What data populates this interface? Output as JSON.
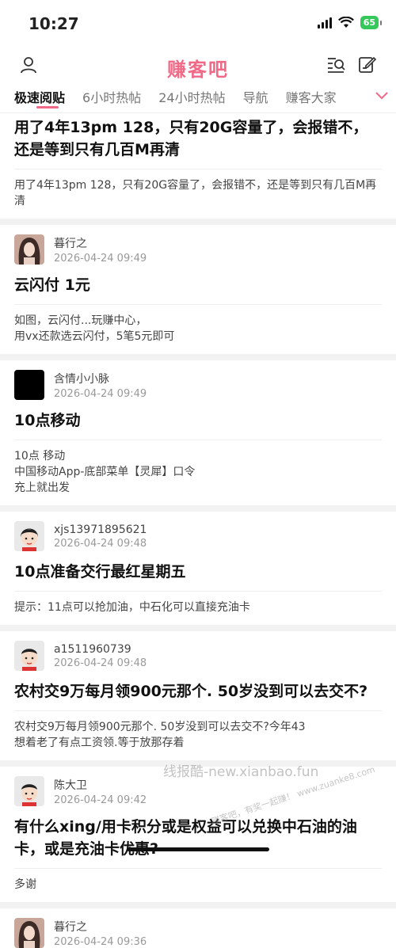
{
  "status": {
    "time": "10:27",
    "battery": "65"
  },
  "header": {
    "title": "赚客吧"
  },
  "tabs": [
    "极速阅贴",
    "6小时热帖",
    "24小时热帖",
    "导航",
    "赚客大家"
  ],
  "posts": [
    {
      "title": "用了4年13pm 128，只有20G容量了，会报错不，还是等到只有几百M再清",
      "summary": "用了4年13pm 128，只有20G容量了，会报错不，还是等到只有几百M再清"
    },
    {
      "author": "暮行之",
      "date": "2026-04-24 09:49",
      "title": "云闪付  1元",
      "summary": "如图，云闪付...玩赚中心，\n用vx还款选云闪付，5笔5元即可"
    },
    {
      "author": "含情小小脉",
      "date": "2026-04-24 09:49",
      "title": "10点移动",
      "summary": "10点 移动\n中国移动App-底部菜单【灵犀】口令\n充上就出发"
    },
    {
      "author": "xjs13971895621",
      "date": "2026-04-24 09:48",
      "title": "10点准备交行最红星期五",
      "summary": "提示：11点可以抢加油，中石化可以直接充油卡"
    },
    {
      "author": "a1511960739",
      "date": "2026-04-24 09:48",
      "title": "农村交9万每月领900元那个. 50岁没到可以去交不?",
      "summary": "农村交9万每月领900元那个. 50岁没到可以去交不?今年43\n想着老了有点工资领.等于放那存着"
    },
    {
      "author": "陈大卫",
      "date": "2026-04-24 09:42",
      "title": "有什么xing/用卡积分或是权益可以兑换中石油的油卡，或是充油卡优惠?",
      "summary": "多谢"
    },
    {
      "author": "暮行之",
      "date": "2026-04-24 09:36"
    }
  ],
  "watermark": "线报酷-new.xianbao.fun",
  "stamp": "赚客吧，有奖一起赚！ www.zuanke8.com",
  "colors": {
    "accent": "#f06a88"
  },
  "icons": [
    "user-icon",
    "search-list-icon",
    "edit-icon",
    "chevron-down-icon"
  ]
}
